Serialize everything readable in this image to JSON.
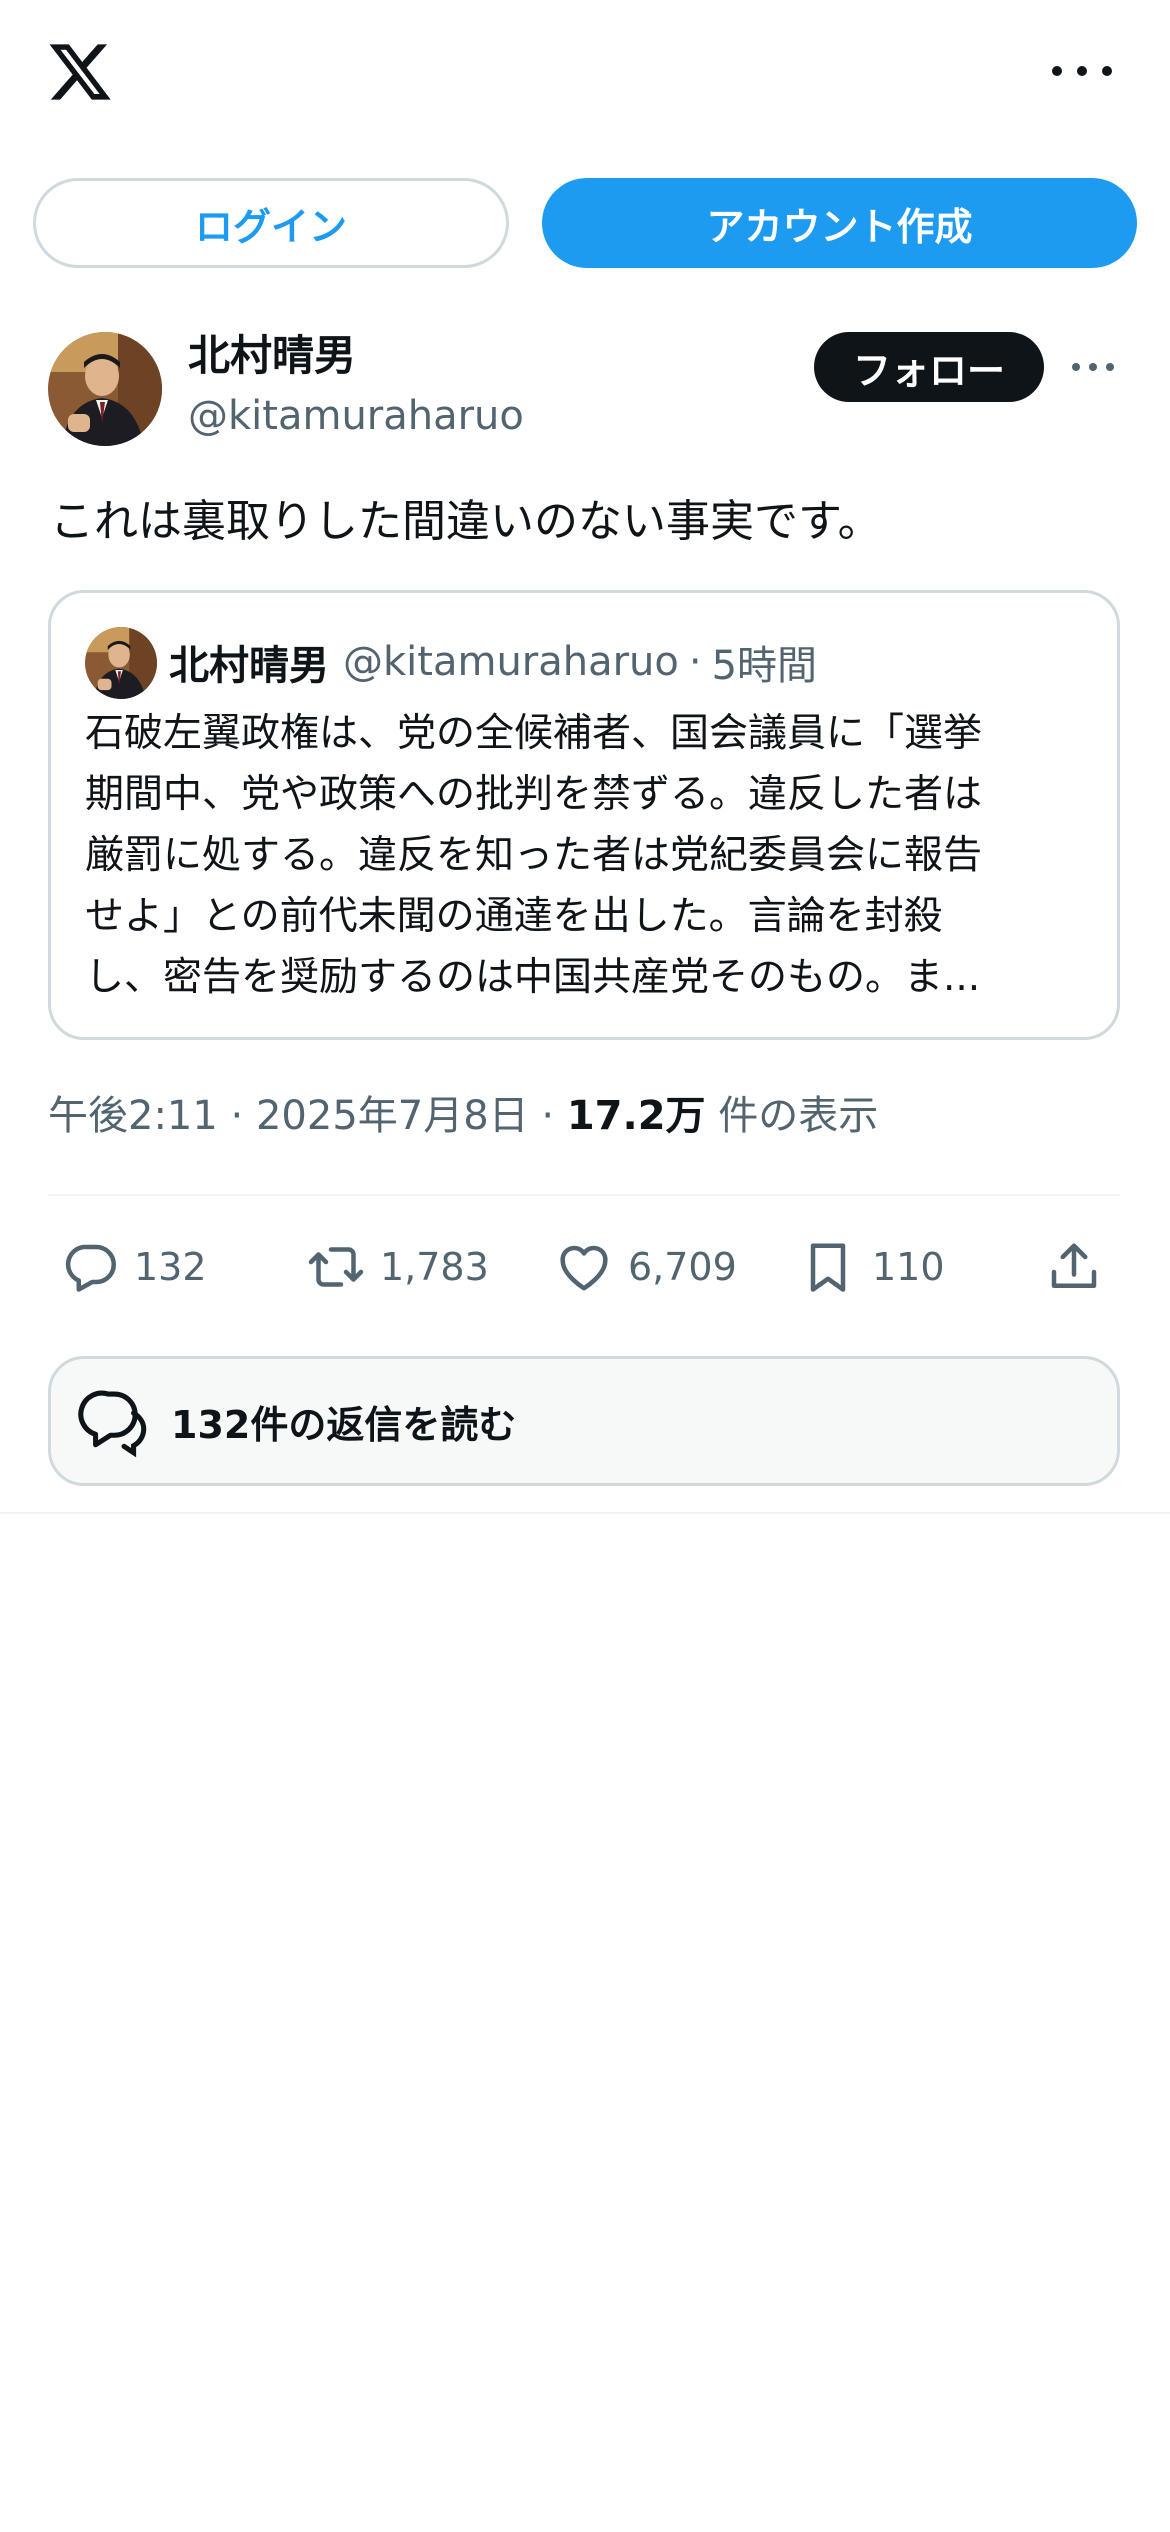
{
  "header": {
    "logo_icon": "x-logo-icon",
    "more_icon": "more-dots-icon"
  },
  "auth": {
    "login_label": "ログイン",
    "signup_label": "アカウント作成"
  },
  "tweet": {
    "author_name": "北村晴男",
    "author_handle": "@kitamuraharuo",
    "follow_label": "フォロー",
    "text": "これは裏取りした間違いのない事実です。",
    "quote": {
      "author_name": "北村晴男",
      "author_handle": "@kitamuraharuo",
      "separator": "·",
      "time": "5時間",
      "lines": [
        "石破左翼政権は、党の全候補者、国会議員に「選挙",
        "期間中、党や政策への批判を禁ずる。違反した者は",
        "厳罰に処する。違反を知った者は党紀委員会に報告",
        "せよ」との前代未聞の通達を出した。言論を封殺",
        "し、密告を奨励するのは中国共産党そのもの。ま..."
      ]
    },
    "time": "午後2:11",
    "dot1": "·",
    "date": "2025年7月8日",
    "dot2": "·",
    "views_count": "17.2万",
    "views_label": "件の表示"
  },
  "actions": {
    "reply_count": "132",
    "retweet_count": "1,783",
    "like_count": "6,709",
    "bookmark_count": "110"
  },
  "replies": {
    "label": "132件の返信を読む"
  },
  "colors": {
    "accent": "#1d9bf0",
    "text_primary": "#0f1419",
    "text_secondary": "#536471",
    "border": "#cfd9de"
  }
}
